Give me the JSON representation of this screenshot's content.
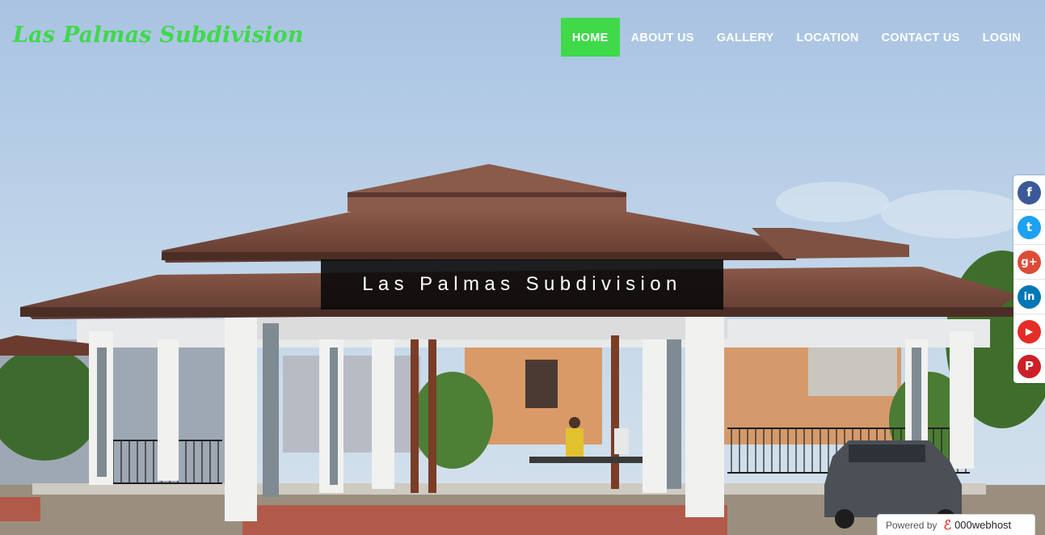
{
  "site": {
    "brand": "Las Palmas Subdivision",
    "hero_title": "Las Palmas Subdivision"
  },
  "nav": {
    "items": [
      {
        "label": "HOME",
        "active": true
      },
      {
        "label": "ABOUT US"
      },
      {
        "label": "GALLERY"
      },
      {
        "label": "LOCATION"
      },
      {
        "label": "CONTACT US"
      },
      {
        "label": "LOGIN"
      }
    ]
  },
  "social": [
    {
      "icon": "facebook-icon",
      "glyph": "f",
      "color": "#3b5998"
    },
    {
      "icon": "twitter-icon",
      "glyph": "t",
      "color": "#1da1f2"
    },
    {
      "icon": "google-plus-icon",
      "glyph": "g+",
      "color": "#dd4b39"
    },
    {
      "icon": "linkedin-icon",
      "glyph": "in",
      "color": "#0077b5"
    },
    {
      "icon": "youtube-icon",
      "glyph": "▶",
      "color": "#e52d27"
    },
    {
      "icon": "pinterest-icon",
      "glyph": "P",
      "color": "#cb2027"
    }
  ],
  "footer_badge": {
    "prefix": "Powered by",
    "brand": "000webhost"
  },
  "colors": {
    "accent": "#3fd94a",
    "sky": "#bcd3e9",
    "roof": "#7a4a3c"
  }
}
